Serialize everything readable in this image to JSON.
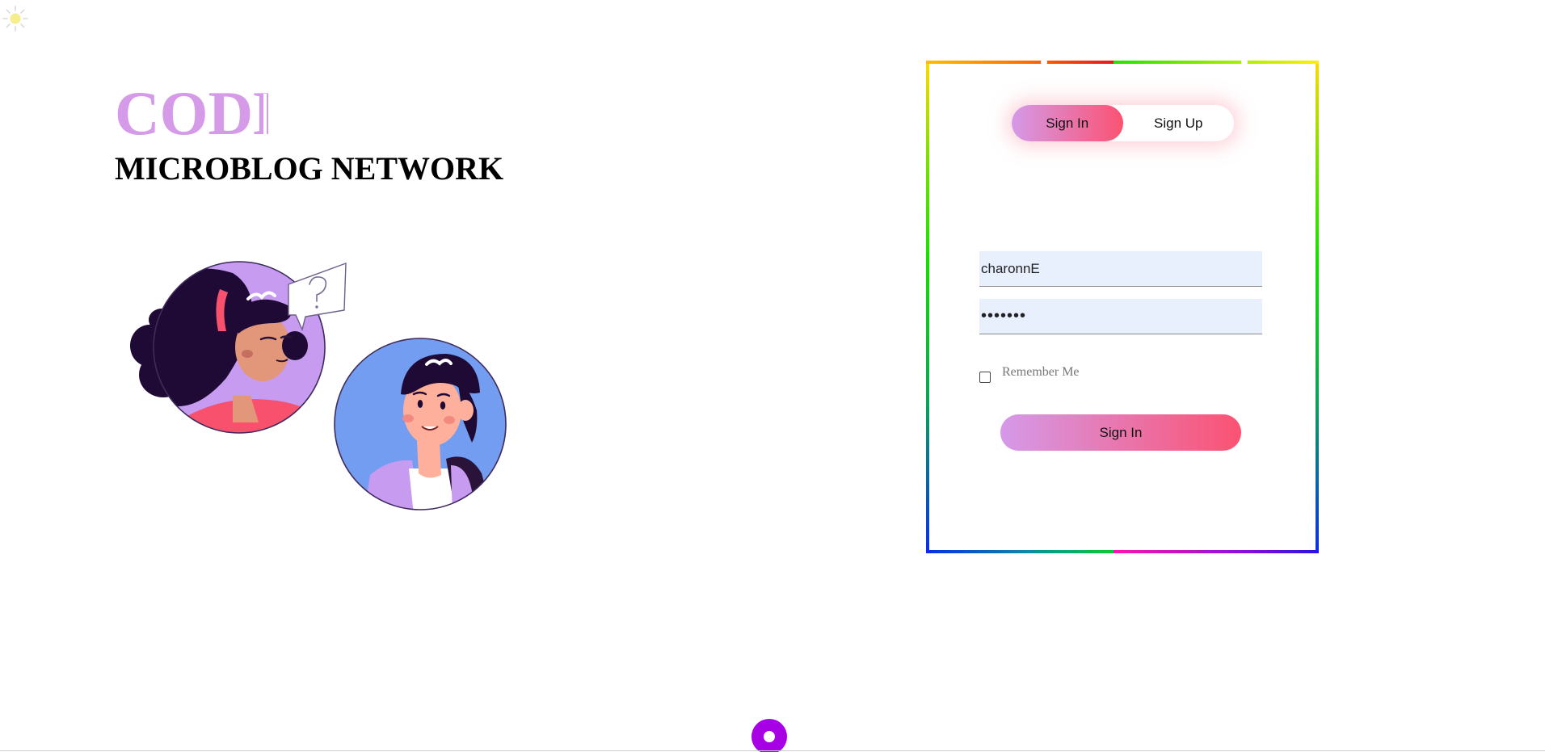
{
  "theme": {
    "toggle_icon": "sun-icon",
    "colors": {
      "brand": "#d59ae8",
      "gradient_start": "#d59ae8",
      "gradient_end": "#fb5272",
      "fab": "#a700e4",
      "input_bg": "#e8effd"
    }
  },
  "brand": {
    "title": "CODE",
    "subtitle": "MICROBLOG NETWORK"
  },
  "auth": {
    "tabs": [
      {
        "label": "Sign In",
        "active": true
      },
      {
        "label": "Sign Up",
        "active": false
      }
    ],
    "username_value": "charonnE",
    "password_value": "1234567",
    "remember_label": "Remember Me",
    "remember_checked": false,
    "submit_label": "Sign In"
  },
  "fab": {
    "icon": "ring-icon"
  }
}
